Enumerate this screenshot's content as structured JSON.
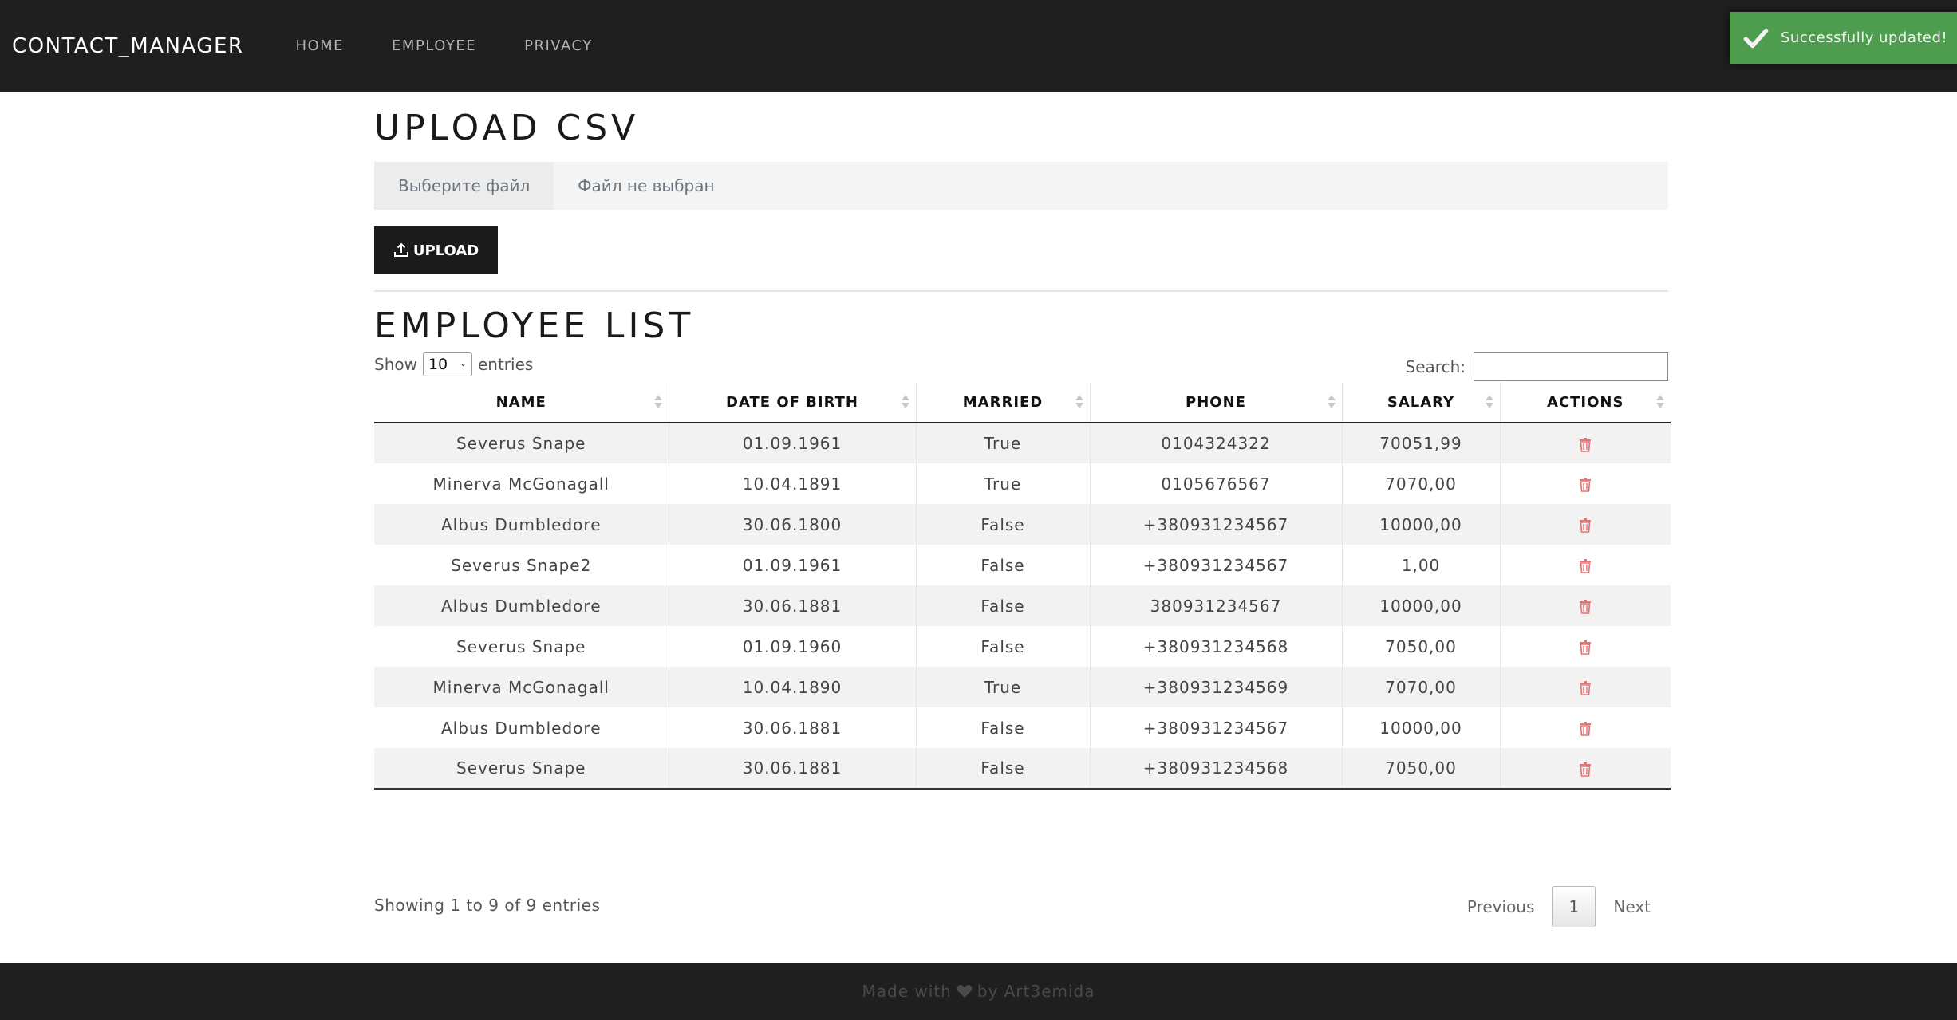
{
  "navbar": {
    "brand": "CONTACT_MANAGER",
    "links": [
      "HOME",
      "EMPLOYEE",
      "PRIVACY"
    ]
  },
  "toast": {
    "message": "Successfully updated!",
    "icon": "check-icon",
    "color": "#51a351"
  },
  "upload": {
    "title": "UPLOAD CSV",
    "file_button": "Выберите файл",
    "file_status": "Файл не выбран",
    "button_label": "UPLOAD",
    "button_icon": "upload-icon"
  },
  "employee_list": {
    "title": "EMPLOYEE LIST",
    "show_label": "Show",
    "page_length": "10",
    "entries_label": "entries",
    "search_label": "Search:",
    "search_value": "",
    "columns": [
      "NAME",
      "DATE OF BIRTH",
      "MARRIED",
      "PHONE",
      "SALARY",
      "ACTIONS"
    ],
    "rows": [
      {
        "name": "Severus Snape",
        "dob": "01.09.1961",
        "married": "True",
        "phone": "0104324322",
        "salary": "70051,99"
      },
      {
        "name": "Minerva McGonagall",
        "dob": "10.04.1891",
        "married": "True",
        "phone": "0105676567",
        "salary": "7070,00"
      },
      {
        "name": "Albus Dumbledore",
        "dob": "30.06.1800",
        "married": "False",
        "phone": "+380931234567",
        "salary": "10000,00"
      },
      {
        "name": "Severus Snape2",
        "dob": "01.09.1961",
        "married": "False",
        "phone": "+380931234567",
        "salary": "1,00"
      },
      {
        "name": "Albus Dumbledore",
        "dob": "30.06.1881",
        "married": "False",
        "phone": "380931234567",
        "salary": "10000,00"
      },
      {
        "name": "Severus Snape",
        "dob": "01.09.1960",
        "married": "False",
        "phone": "+380931234568",
        "salary": "7050,00"
      },
      {
        "name": "Minerva McGonagall",
        "dob": "10.04.1890",
        "married": "True",
        "phone": "+380931234569",
        "salary": "7070,00"
      },
      {
        "name": "Albus Dumbledore",
        "dob": "30.06.1881",
        "married": "False",
        "phone": "+380931234567",
        "salary": "10000,00"
      },
      {
        "name": "Severus Snape",
        "dob": "30.06.1881",
        "married": "False",
        "phone": "+380931234568",
        "salary": "7050,00"
      }
    ],
    "action_icon": "trash-icon",
    "info": "Showing 1 to 9 of 9 entries",
    "pagination": {
      "previous": "Previous",
      "current": "1",
      "next": "Next"
    }
  },
  "footer": {
    "made_with": "Made with",
    "by": "by Art3emida",
    "icon": "heart-icon"
  }
}
